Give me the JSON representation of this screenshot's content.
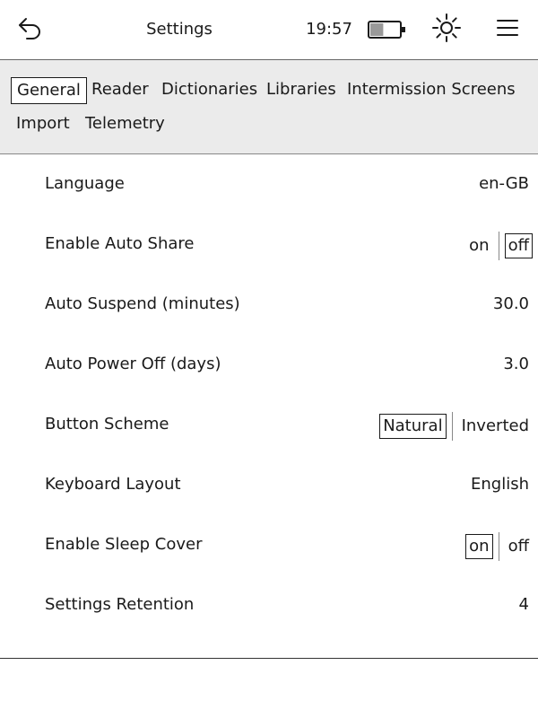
{
  "topbar": {
    "back_icon": "back-arrow-icon",
    "title": "Settings",
    "clock": "19:57",
    "battery_icon": "battery-icon",
    "battery_level": 0.45,
    "frontlight_icon": "sun-icon",
    "menu_icon": "hamburger-menu-icon"
  },
  "tabs": [
    {
      "label": "General",
      "selected": true
    },
    {
      "label": "Reader",
      "selected": false
    },
    {
      "label": "Dictionaries",
      "selected": false
    },
    {
      "label": "Libraries",
      "selected": false
    },
    {
      "label": "Intermission Screens",
      "selected": false
    },
    {
      "label": "Import",
      "selected": false
    },
    {
      "label": "Telemetry",
      "selected": false
    }
  ],
  "settings": {
    "language": {
      "label": "Language",
      "value": "en-GB"
    },
    "auto_share": {
      "label": "Enable Auto Share",
      "on": "on",
      "off": "off",
      "selected": "off"
    },
    "auto_suspend": {
      "label": "Auto Suspend (minutes)",
      "value": "30.0"
    },
    "auto_power_off": {
      "label": "Auto Power Off (days)",
      "value": "3.0"
    },
    "button_scheme": {
      "label": "Button Scheme",
      "natural": "Natural",
      "inverted": "Inverted",
      "selected": "Natural"
    },
    "keyboard_layout": {
      "label": "Keyboard Layout",
      "value": "English"
    },
    "sleep_cover": {
      "label": "Enable Sleep Cover",
      "on": "on",
      "off": "off",
      "selected": "on"
    },
    "settings_retention": {
      "label": "Settings Retention",
      "value": "4"
    }
  },
  "colors": {
    "tab_bar_bg": "#ebebeb",
    "text": "#1a1a1a",
    "border": "#1a1a1a"
  }
}
